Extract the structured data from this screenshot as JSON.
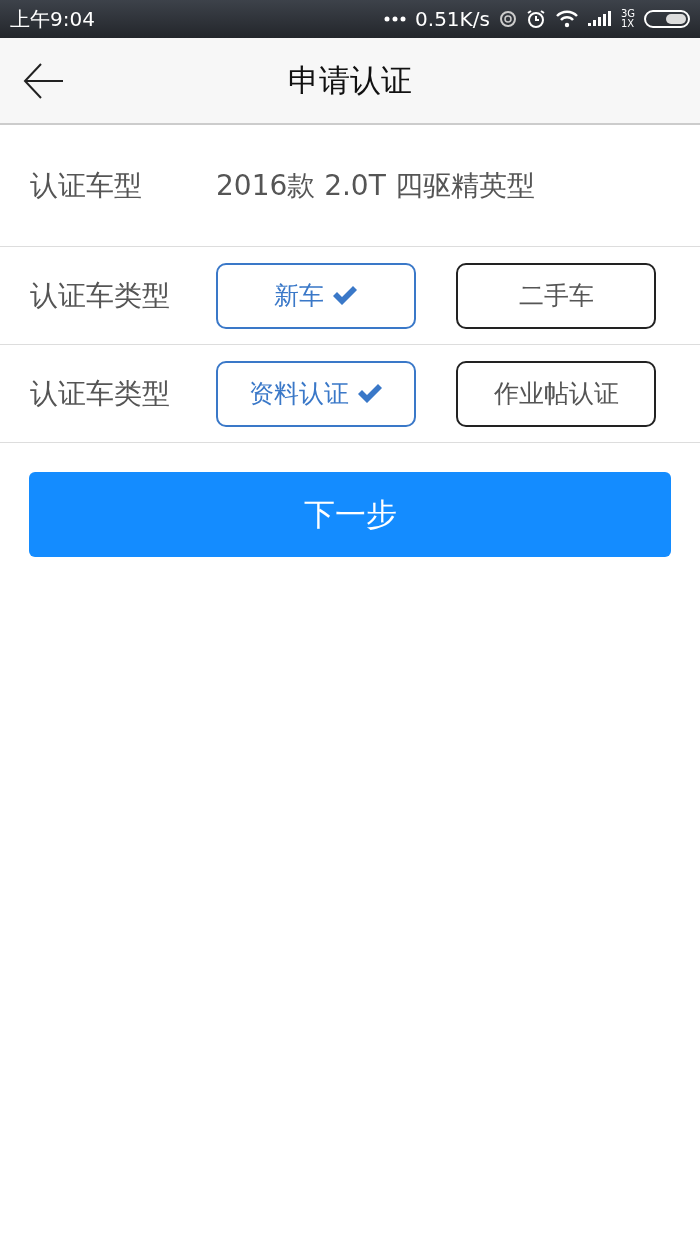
{
  "status_bar": {
    "time": "上午9:04",
    "speed": "0.51K/s",
    "network_top": "3G",
    "network_bottom": "1X"
  },
  "header": {
    "title": "申请认证"
  },
  "model_row": {
    "label": "认证车型",
    "value": "2016款 2.0T 四驱精英型"
  },
  "option_rows": [
    {
      "label": "认证车类型",
      "options": [
        {
          "label": "新车",
          "selected": true
        },
        {
          "label": "二手车",
          "selected": false
        }
      ]
    },
    {
      "label": "认证车类型",
      "options": [
        {
          "label": "资料认证",
          "selected": true
        },
        {
          "label": "作业帖认证",
          "selected": false
        }
      ]
    }
  ],
  "next_button": "下一步"
}
